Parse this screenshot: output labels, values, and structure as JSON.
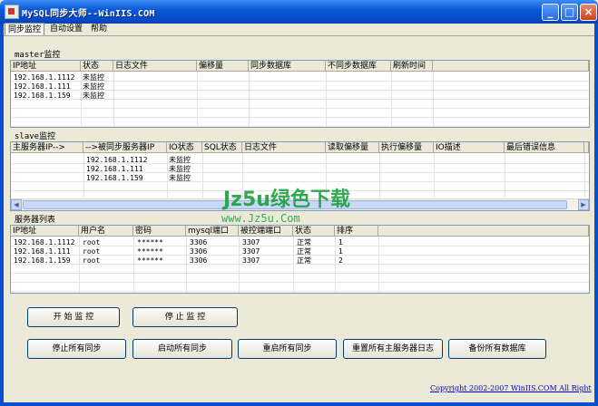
{
  "window": {
    "title": "MySQL同步大师--WinIIS.COM"
  },
  "tabs": [
    "同步监控",
    "自动设置",
    "帮助"
  ],
  "master": {
    "label": "master监控",
    "columns": [
      "IP地址",
      "状态",
      "日志文件",
      "偏移量",
      "同步数据库",
      "不同步数据库",
      "刷新时间"
    ],
    "rows": [
      [
        "192.168.1.1112",
        "未监控"
      ],
      [
        "192.168.1.111",
        "未监控"
      ],
      [
        "192.168.1.159",
        "未监控"
      ]
    ]
  },
  "slave": {
    "label": "slave监控",
    "columns": [
      "主服务器IP-->",
      "-->被同步服务器IP",
      "IO状态",
      "SQL状态",
      "日志文件",
      "读取偏移量",
      "执行偏移量",
      "IO描述",
      "最后错误信息"
    ],
    "rows": [
      [
        "192.168.1.1112",
        "未监控"
      ],
      [
        "192.168.1.111",
        "未监控"
      ],
      [
        "192.168.1.159",
        "未监控"
      ]
    ]
  },
  "servers": {
    "label": "服务器列表",
    "columns": [
      "IP地址",
      "用户名",
      "密码",
      "mysql端口",
      "被控端端口",
      "状态",
      "排序"
    ],
    "rows": [
      [
        "192.168.1.1112",
        "root",
        "******",
        "3306",
        "3307",
        "正常",
        "1"
      ],
      [
        "192.168.1.111",
        "root",
        "******",
        "3306",
        "3307",
        "正常",
        "1"
      ],
      [
        "192.168.1.159",
        "root",
        "******",
        "3306",
        "3307",
        "正常",
        "2"
      ]
    ]
  },
  "buttons": {
    "start": "开 始 监 控",
    "stop": "停 止 监 控",
    "stop_all": "停止所有同步",
    "start_all": "启动所有同步",
    "restart_all": "重启所有同步",
    "reset_logs": "重置所有主服务器日志",
    "backup": "备份所有数据库"
  },
  "watermark": {
    "main": "Jz5u绿色下载",
    "sub": "www.Jz5u.Com"
  },
  "copyright": "Copyright 2002-2007 WinIIS.COM All Right"
}
